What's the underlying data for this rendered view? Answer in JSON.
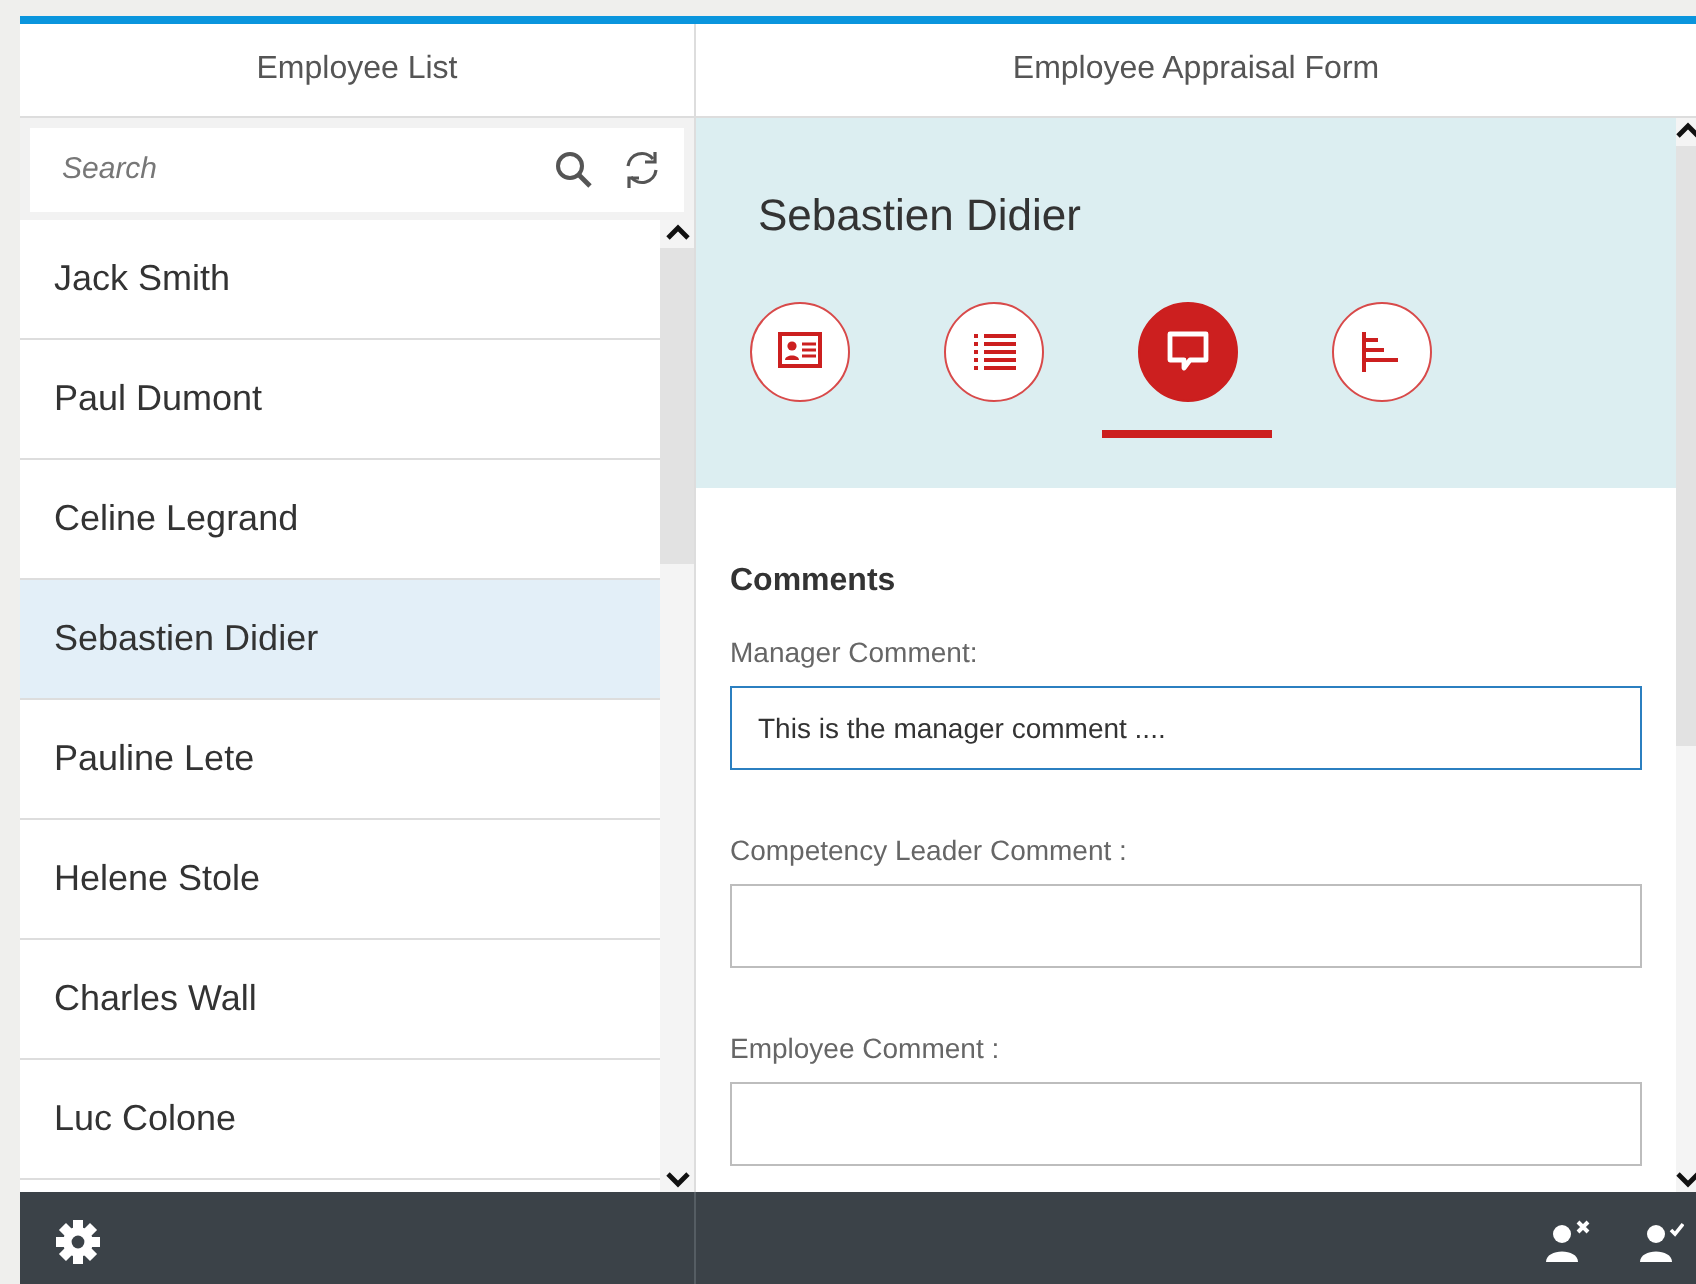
{
  "list_panel": {
    "title": "Employee List",
    "search": {
      "placeholder": "Search"
    },
    "employees": [
      {
        "name": "Jack Smith",
        "selected": false
      },
      {
        "name": "Paul Dumont",
        "selected": false
      },
      {
        "name": "Celine Legrand",
        "selected": false
      },
      {
        "name": "Sebastien Didier",
        "selected": true
      },
      {
        "name": "Pauline Lete",
        "selected": false
      },
      {
        "name": "Helene Stole",
        "selected": false
      },
      {
        "name": "Charles Wall",
        "selected": false
      },
      {
        "name": "Luc Colone",
        "selected": false
      }
    ]
  },
  "form_panel": {
    "title": "Employee Appraisal Form",
    "employee_name": "Sebastien Didier",
    "tabs": [
      {
        "kind": "profile",
        "selected": false
      },
      {
        "kind": "list",
        "selected": false
      },
      {
        "kind": "comment",
        "selected": true
      },
      {
        "kind": "chart",
        "selected": false
      }
    ],
    "section_title": "Comments",
    "fields": [
      {
        "label": "Manager Comment:",
        "value": "This is the manager comment ....",
        "focused": true
      },
      {
        "label": "Competency Leader Comment :",
        "focused": false
      },
      {
        "label": "Employee Comment :",
        "focused": false
      }
    ]
  },
  "footer": {
    "actions": [
      {
        "kind": "reject"
      },
      {
        "kind": "approve"
      }
    ]
  }
}
